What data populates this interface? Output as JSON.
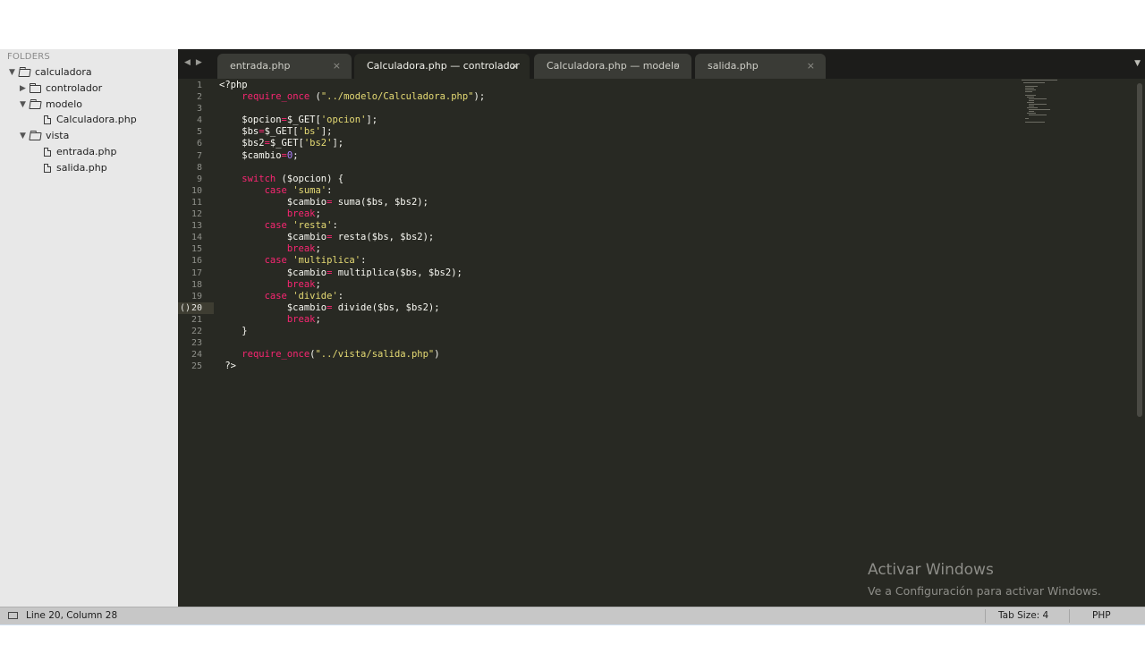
{
  "sidebar": {
    "title": "FOLDERS",
    "tree": [
      {
        "label": "calculadora",
        "type": "folder",
        "expanded": true,
        "level": 0
      },
      {
        "label": "controlador",
        "type": "folder",
        "expanded": false,
        "level": 1
      },
      {
        "label": "modelo",
        "type": "folder",
        "expanded": true,
        "level": 1
      },
      {
        "label": "Calculadora.php",
        "type": "file",
        "level": 2
      },
      {
        "label": "vista",
        "type": "folder",
        "expanded": true,
        "level": 1
      },
      {
        "label": "entrada.php",
        "type": "file",
        "level": 2
      },
      {
        "label": "salida.php",
        "type": "file",
        "level": 2
      }
    ]
  },
  "tabs": [
    {
      "label": "entrada.php",
      "active": false
    },
    {
      "label": "Calculadora.php — controlador",
      "active": true
    },
    {
      "label": "Calculadora.php — modelo",
      "active": false
    },
    {
      "label": "salida.php",
      "active": false
    }
  ],
  "tab_close_glyph": "×",
  "nav": {
    "back": "◀",
    "forward": "▶",
    "dropdown": "▼"
  },
  "editor": {
    "current_line": 20,
    "lines": [
      "<?php",
      "    require_once (\"../modelo/Calculadora.php\");",
      "",
      "    $opcion=$_GET['opcion'];",
      "    $bs=$_GET['bs'];",
      "    $bs2=$_GET['bs2'];",
      "    $cambio=0;",
      "",
      "    switch ($opcion) {",
      "        case 'suma':",
      "            $cambio= suma($bs, $bs2);",
      "            break;",
      "        case 'resta':",
      "            $cambio= resta($bs, $bs2);",
      "            break;",
      "        case 'multiplica':",
      "            $cambio= multiplica($bs, $bs2);",
      "            break;",
      "        case 'divide':",
      "            $cambio= divide($bs, $bs2);",
      "            break;",
      "    }",
      "",
      "    require_once(\"../vista/salida.php\")",
      " ?>"
    ],
    "fold_marker": "()"
  },
  "watermark": {
    "title": "Activar Windows",
    "subtitle": "Ve a Configuración para activar Windows."
  },
  "statusbar": {
    "position": "Line 20, Column 28",
    "tab_size": "Tab Size: 4",
    "syntax": "PHP"
  },
  "colors": {
    "editor_bg": "#282923",
    "keyword": "#f92672",
    "function": "#66d9ef",
    "string": "#e6db74",
    "number": "#ae81ff"
  }
}
